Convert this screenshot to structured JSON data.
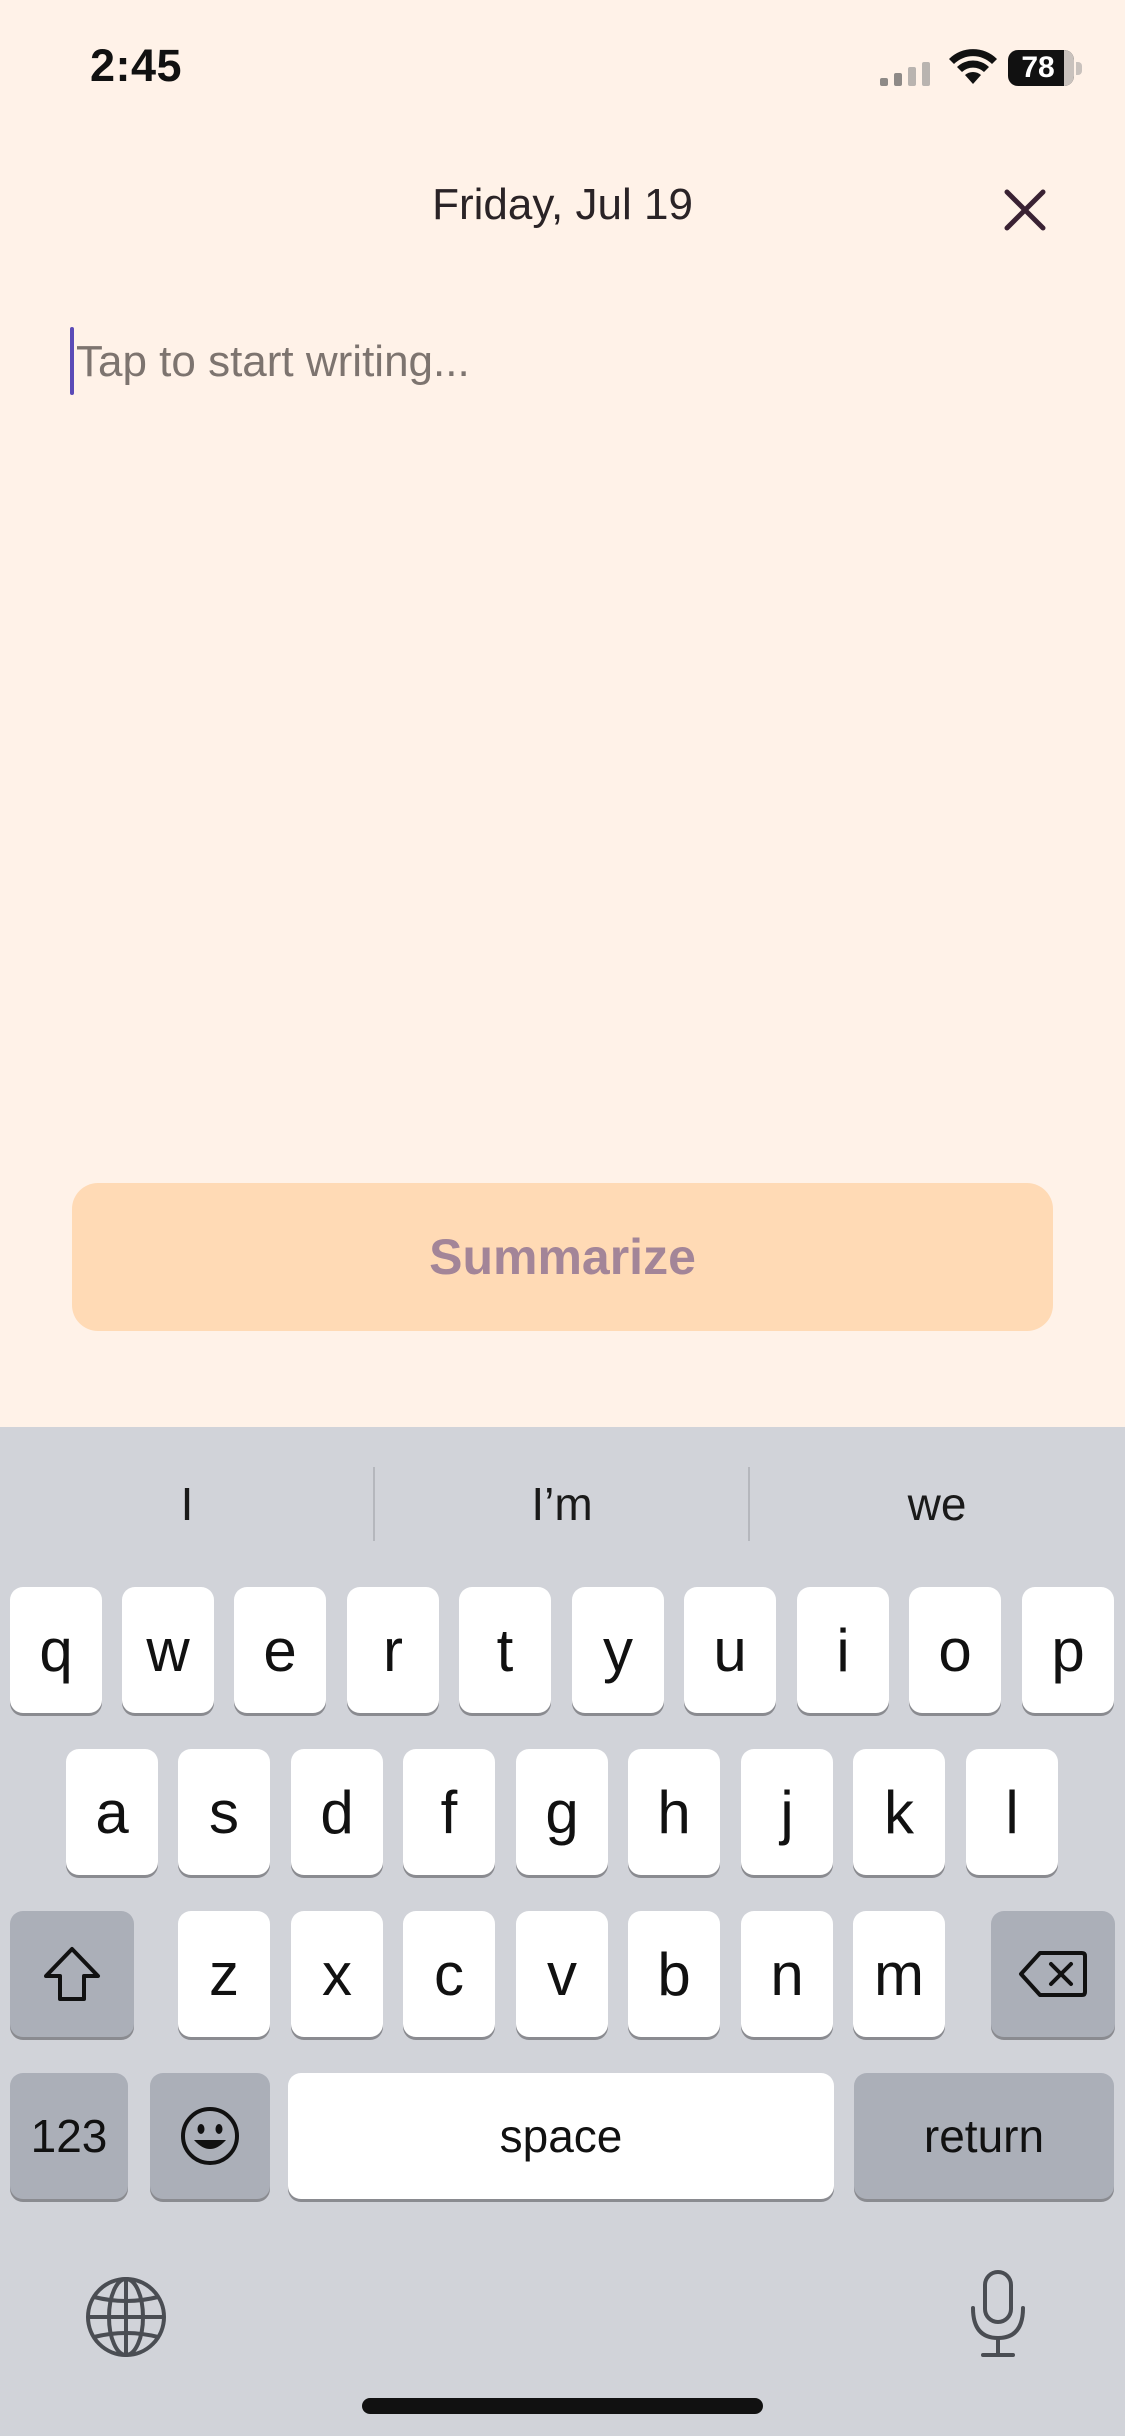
{
  "status_bar": {
    "time": "2:45",
    "battery_level": "78",
    "battery_fraction": 0.78
  },
  "header": {
    "date_title": "Friday, Jul 19",
    "close_icon": "close-icon"
  },
  "editor": {
    "placeholder": "Tap to start writing...",
    "value": ""
  },
  "actions": {
    "summarize_label": "Summarize"
  },
  "keyboard": {
    "suggestions": [
      "I",
      "I’m",
      "we"
    ],
    "row1": [
      "q",
      "w",
      "e",
      "r",
      "t",
      "y",
      "u",
      "i",
      "o",
      "p"
    ],
    "row2": [
      "a",
      "s",
      "d",
      "f",
      "g",
      "h",
      "j",
      "k",
      "l"
    ],
    "row3": [
      "z",
      "x",
      "c",
      "v",
      "b",
      "n",
      "m"
    ],
    "numbers_label": "123",
    "space_label": "space",
    "return_label": "return",
    "icons": {
      "shift": "shift-icon",
      "delete": "backspace-icon",
      "emoji": "emoji-icon",
      "globe": "globe-icon",
      "mic": "microphone-icon"
    }
  },
  "colors": {
    "background": "#FFF2E8",
    "caret": "#5B4BB7",
    "summarize_bg": "#FFDAB5",
    "summarize_text": "#A38598",
    "keyboard_bg": "#D1D3D9"
  }
}
